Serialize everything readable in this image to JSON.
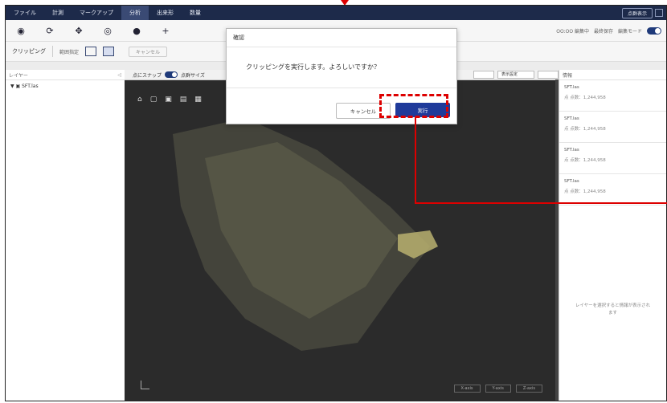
{
  "menubar": {
    "items": [
      {
        "label": "ファイル",
        "active": false
      },
      {
        "label": "計測",
        "active": false
      },
      {
        "label": "マークアップ",
        "active": false
      },
      {
        "label": "分析",
        "active": true
      },
      {
        "label": "出来形",
        "active": false
      },
      {
        "label": "数量",
        "active": false
      }
    ],
    "right_button": "点群表示"
  },
  "toolbar1": {
    "tools": [
      "select-icon",
      "rotate-icon",
      "move-icon",
      "orbit-icon",
      "paint-icon",
      "crosshair-icon"
    ],
    "right_text": "OO:OO 編集中",
    "right_sub": "最終保存",
    "mode_label": "編集モード"
  },
  "toolbar2": {
    "label": "クリッピング",
    "small_label": "範囲指定",
    "cancel": "キャンセル"
  },
  "left_panel": {
    "header": "レイヤー",
    "items": [
      "▼ ▣ SFT.las"
    ]
  },
  "viewport": {
    "snap_label": "点にスナップ",
    "size_label": "点群サイズ",
    "dropdowns": [
      "",
      "表示設定",
      ""
    ],
    "bottom_buttons": [
      "X-axis",
      "Y-axis",
      "Z-axis"
    ]
  },
  "right_panel": {
    "header": "情報",
    "cards": [
      {
        "title": "SFT.las",
        "sub": "点 点数：1,244,958"
      },
      {
        "title": "SFT.las",
        "sub": "点 点数：1,244,958"
      },
      {
        "title": "SFT.las",
        "sub": "点 点数：1,244,958"
      },
      {
        "title": "SFT.las",
        "sub": "点 点数：1,244,958"
      }
    ],
    "note_line1": "レイヤーを選択すると情報が表示され",
    "note_line2": "ます"
  },
  "modal": {
    "title": "確認",
    "message": "クリッピングを実行します。よろしいですか？",
    "cancel": "キャンセル",
    "confirm": "実行"
  },
  "colors": {
    "menubar": "#1d2a4a",
    "accent": "#1f3a9a",
    "highlight": "#dd0000"
  }
}
